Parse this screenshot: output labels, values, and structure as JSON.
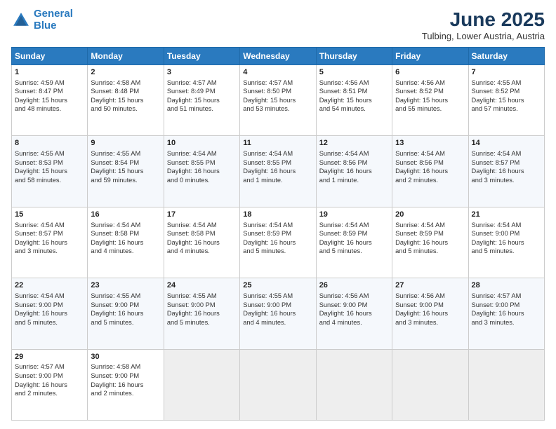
{
  "header": {
    "logo_line1": "General",
    "logo_line2": "Blue",
    "month": "June 2025",
    "location": "Tulbing, Lower Austria, Austria"
  },
  "days_of_week": [
    "Sunday",
    "Monday",
    "Tuesday",
    "Wednesday",
    "Thursday",
    "Friday",
    "Saturday"
  ],
  "weeks": [
    [
      {
        "day": "1",
        "info": "Sunrise: 4:59 AM\nSunset: 8:47 PM\nDaylight: 15 hours\nand 48 minutes."
      },
      {
        "day": "2",
        "info": "Sunrise: 4:58 AM\nSunset: 8:48 PM\nDaylight: 15 hours\nand 50 minutes."
      },
      {
        "day": "3",
        "info": "Sunrise: 4:57 AM\nSunset: 8:49 PM\nDaylight: 15 hours\nand 51 minutes."
      },
      {
        "day": "4",
        "info": "Sunrise: 4:57 AM\nSunset: 8:50 PM\nDaylight: 15 hours\nand 53 minutes."
      },
      {
        "day": "5",
        "info": "Sunrise: 4:56 AM\nSunset: 8:51 PM\nDaylight: 15 hours\nand 54 minutes."
      },
      {
        "day": "6",
        "info": "Sunrise: 4:56 AM\nSunset: 8:52 PM\nDaylight: 15 hours\nand 55 minutes."
      },
      {
        "day": "7",
        "info": "Sunrise: 4:55 AM\nSunset: 8:52 PM\nDaylight: 15 hours\nand 57 minutes."
      }
    ],
    [
      {
        "day": "8",
        "info": "Sunrise: 4:55 AM\nSunset: 8:53 PM\nDaylight: 15 hours\nand 58 minutes."
      },
      {
        "day": "9",
        "info": "Sunrise: 4:55 AM\nSunset: 8:54 PM\nDaylight: 15 hours\nand 59 minutes."
      },
      {
        "day": "10",
        "info": "Sunrise: 4:54 AM\nSunset: 8:55 PM\nDaylight: 16 hours\nand 0 minutes."
      },
      {
        "day": "11",
        "info": "Sunrise: 4:54 AM\nSunset: 8:55 PM\nDaylight: 16 hours\nand 1 minute."
      },
      {
        "day": "12",
        "info": "Sunrise: 4:54 AM\nSunset: 8:56 PM\nDaylight: 16 hours\nand 1 minute."
      },
      {
        "day": "13",
        "info": "Sunrise: 4:54 AM\nSunset: 8:56 PM\nDaylight: 16 hours\nand 2 minutes."
      },
      {
        "day": "14",
        "info": "Sunrise: 4:54 AM\nSunset: 8:57 PM\nDaylight: 16 hours\nand 3 minutes."
      }
    ],
    [
      {
        "day": "15",
        "info": "Sunrise: 4:54 AM\nSunset: 8:57 PM\nDaylight: 16 hours\nand 3 minutes."
      },
      {
        "day": "16",
        "info": "Sunrise: 4:54 AM\nSunset: 8:58 PM\nDaylight: 16 hours\nand 4 minutes."
      },
      {
        "day": "17",
        "info": "Sunrise: 4:54 AM\nSunset: 8:58 PM\nDaylight: 16 hours\nand 4 minutes."
      },
      {
        "day": "18",
        "info": "Sunrise: 4:54 AM\nSunset: 8:59 PM\nDaylight: 16 hours\nand 5 minutes."
      },
      {
        "day": "19",
        "info": "Sunrise: 4:54 AM\nSunset: 8:59 PM\nDaylight: 16 hours\nand 5 minutes."
      },
      {
        "day": "20",
        "info": "Sunrise: 4:54 AM\nSunset: 8:59 PM\nDaylight: 16 hours\nand 5 minutes."
      },
      {
        "day": "21",
        "info": "Sunrise: 4:54 AM\nSunset: 9:00 PM\nDaylight: 16 hours\nand 5 minutes."
      }
    ],
    [
      {
        "day": "22",
        "info": "Sunrise: 4:54 AM\nSunset: 9:00 PM\nDaylight: 16 hours\nand 5 minutes."
      },
      {
        "day": "23",
        "info": "Sunrise: 4:55 AM\nSunset: 9:00 PM\nDaylight: 16 hours\nand 5 minutes."
      },
      {
        "day": "24",
        "info": "Sunrise: 4:55 AM\nSunset: 9:00 PM\nDaylight: 16 hours\nand 5 minutes."
      },
      {
        "day": "25",
        "info": "Sunrise: 4:55 AM\nSunset: 9:00 PM\nDaylight: 16 hours\nand 4 minutes."
      },
      {
        "day": "26",
        "info": "Sunrise: 4:56 AM\nSunset: 9:00 PM\nDaylight: 16 hours\nand 4 minutes."
      },
      {
        "day": "27",
        "info": "Sunrise: 4:56 AM\nSunset: 9:00 PM\nDaylight: 16 hours\nand 3 minutes."
      },
      {
        "day": "28",
        "info": "Sunrise: 4:57 AM\nSunset: 9:00 PM\nDaylight: 16 hours\nand 3 minutes."
      }
    ],
    [
      {
        "day": "29",
        "info": "Sunrise: 4:57 AM\nSunset: 9:00 PM\nDaylight: 16 hours\nand 2 minutes."
      },
      {
        "day": "30",
        "info": "Sunrise: 4:58 AM\nSunset: 9:00 PM\nDaylight: 16 hours\nand 2 minutes."
      },
      null,
      null,
      null,
      null,
      null
    ]
  ]
}
